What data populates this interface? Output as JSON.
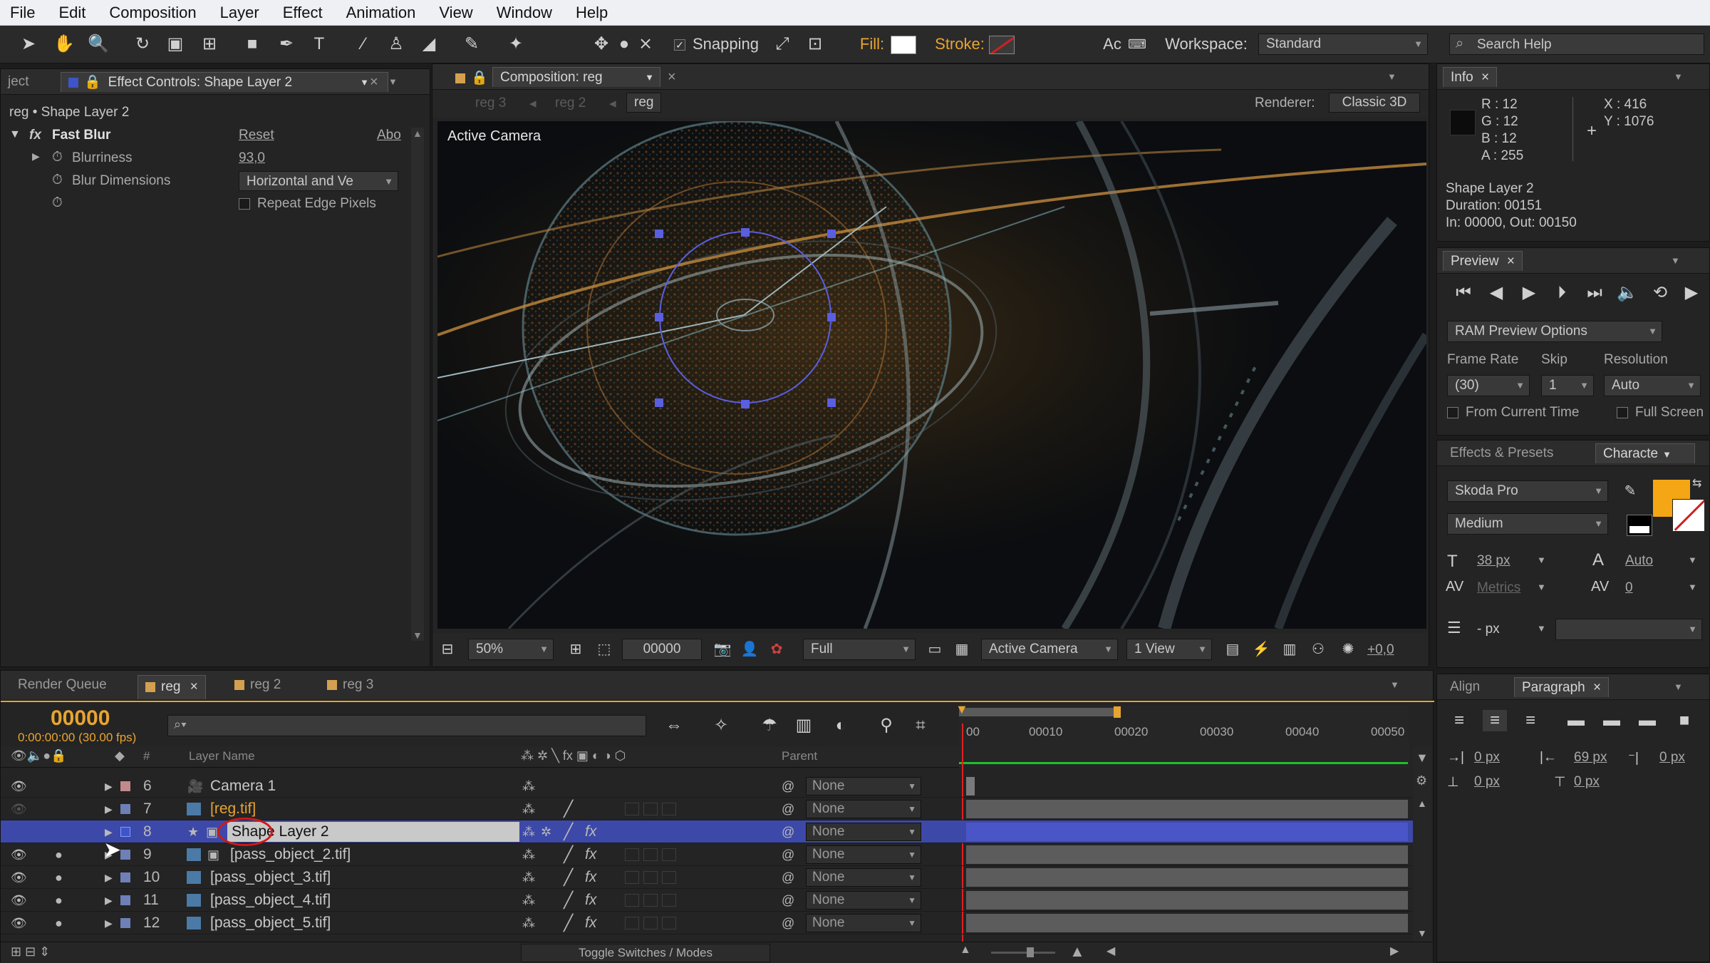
{
  "menu": [
    "File",
    "Edit",
    "Composition",
    "Layer",
    "Effect",
    "Animation",
    "View",
    "Window",
    "Help"
  ],
  "toolbar": {
    "snapping_label": "Snapping",
    "fill_label": "Fill:",
    "stroke_label": "Stroke:",
    "ac_label": "Ac",
    "workspace_label": "Workspace:",
    "workspace_value": "Standard",
    "search_placeholder": "Search Help"
  },
  "effect_panel": {
    "left_tab": "ject",
    "tab_title": "Effect Controls: Shape Layer 2",
    "breadcrumb": "reg • Shape Layer 2",
    "effect_name": "Fast Blur",
    "reset_label": "Reset",
    "about_label": "Abo",
    "params": [
      {
        "label": "Blurriness",
        "value": "93,0"
      },
      {
        "label": "Blur Dimensions",
        "value": "Horizontal and Ve"
      },
      {
        "label": "Repeat Edge Pixels",
        "value": ""
      }
    ]
  },
  "composition": {
    "tab_title": "Composition: reg",
    "crumbs": [
      "reg 3",
      "reg 2",
      "reg"
    ],
    "renderer_label": "Renderer:",
    "renderer_value": "Classic 3D",
    "viewer_label": "Active Camera",
    "bottom": {
      "zoom": "50%",
      "timecode": "00000",
      "resolution": "Full",
      "camera": "Active Camera",
      "views": "1 View",
      "exposure": "+0,0"
    }
  },
  "info_panel": {
    "title": "Info",
    "r": "R : 12",
    "g": "G : 12",
    "b": "B : 12",
    "a": "A : 255",
    "x": "X : 416",
    "y": "Y : 1076",
    "layer_name": "Shape Layer 2",
    "duration": "Duration: 00151",
    "inout": "In: 00000, Out: 00150"
  },
  "preview_panel": {
    "title": "Preview",
    "options_value": "RAM Preview Options",
    "frame_rate_label": "Frame Rate",
    "skip_label": "Skip",
    "resolution_label": "Resolution",
    "frame_rate_value": "(30)",
    "skip_value": "1",
    "resolution_value": "Auto",
    "from_current_label": "From Current Time",
    "full_screen_label": "Full Screen"
  },
  "character_panel": {
    "tab_effects": "Effects & Presets",
    "tab_character": "Characte",
    "font_family": "Skoda Pro",
    "font_style": "Medium",
    "font_size": "38 px",
    "leading": "Auto",
    "kerning": "Metrics",
    "tracking": "0",
    "stroke_width": "- px",
    "fill_color": "#f5a614"
  },
  "paragraph_panel": {
    "tab_align": "Align",
    "tab_paragraph": "Paragraph",
    "indent_left": "0 px",
    "indent_right": "69 px",
    "indent_first": "0 px",
    "space_before": "0 px",
    "space_after": "0 px"
  },
  "timeline": {
    "tabs": [
      "Render Queue",
      "reg",
      "reg 2",
      "reg 3"
    ],
    "timecode": "00000",
    "timecode_sub": "0:00:00:00 (30.00 fps)",
    "col_layer_name": "Layer Name",
    "col_number": "#",
    "col_parent": "Parent",
    "ruler": [
      "00",
      "00010",
      "00020",
      "00030",
      "00040",
      "00050"
    ],
    "toggle_label": "Toggle Switches / Modes",
    "layers": [
      {
        "num": "6",
        "name": "Camera 1",
        "parent": "None",
        "color": "#c28a8a"
      },
      {
        "num": "7",
        "name": "[reg.tif]",
        "parent": "None",
        "color": "#6f7fb8"
      },
      {
        "num": "8",
        "name": "Shape Layer 2",
        "parent": "None",
        "color": "#3d55c8"
      },
      {
        "num": "9",
        "name": "[pass_object_2.tif]",
        "parent": "None",
        "color": "#6f7fb8"
      },
      {
        "num": "10",
        "name": "[pass_object_3.tif]",
        "parent": "None",
        "color": "#6f7fb8"
      },
      {
        "num": "11",
        "name": "[pass_object_4.tif]",
        "parent": "None",
        "color": "#6f7fb8"
      },
      {
        "num": "12",
        "name": "[pass_object_5.tif]",
        "parent": "None",
        "color": "#6f7fb8"
      }
    ]
  },
  "colors": {
    "accent": "#e8a430",
    "selection_blue": "#3d49a8",
    "shape_path": "#5a5ee0"
  }
}
